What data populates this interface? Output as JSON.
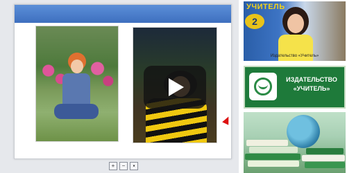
{
  "slide": {
    "play_icon": "play-icon"
  },
  "zoom_bar": {
    "zoom_in_label": "+",
    "zoom_out_label": "−",
    "save_label": "▪"
  },
  "video_thumb": {
    "logo_text": "УЧИТЕЛЬ",
    "badge_text": "2",
    "caption": "Издательство «Учитель»"
  },
  "publisher": {
    "line1": "ИЗДАТЕЛЬСТВО",
    "line2": "«УЧИТЕЛЬ»"
  },
  "colors": {
    "header_blue": "#3e6fbf",
    "logo_green": "#1e7a3a"
  }
}
